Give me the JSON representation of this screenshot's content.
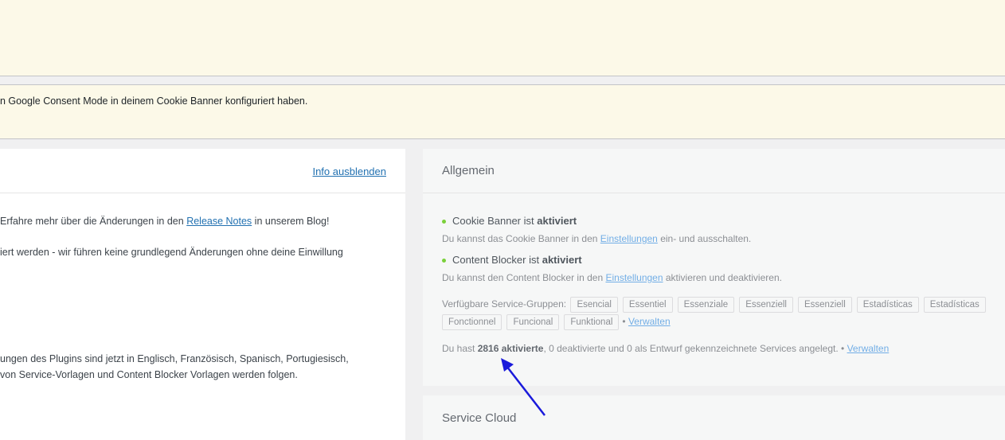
{
  "consent_notice": {
    "text": "n Google Consent Mode in deinem Cookie Banner konfiguriert haben."
  },
  "left_card": {
    "hide_info_link": "Info ausblenden",
    "line1_prefix": "Erfahre mehr über die Änderungen in den ",
    "line1_link": "Release Notes",
    "line1_suffix": " in unserem Blog!",
    "line2": "iert werden - wir führen keine grundlegend Änderungen ohne deine Einwillung",
    "line3": "ungen des Plugins sind jetzt in Englisch, Französisch, Spanisch, Portugiesisch,",
    "line4": "von Service-Vorlagen und Content Blocker Vorlagen werden folgen."
  },
  "general": {
    "title": "Allgemein",
    "cookie_banner": {
      "label": "Cookie Banner ist ",
      "status": "aktiviert",
      "help_prefix": "Du kannst das Cookie Banner in den ",
      "help_link": "Einstellungen",
      "help_suffix": " ein- und ausschalten."
    },
    "content_blocker": {
      "label": "Content Blocker ist ",
      "status": "aktiviert",
      "help_prefix": "Du kannst den Content Blocker in den ",
      "help_link": "Einstellungen",
      "help_suffix": " aktivieren und deaktivieren."
    },
    "service_groups": {
      "label": "Verfügbare Service-Gruppen:",
      "groups": [
        "Esencial",
        "Essentiel",
        "Essenziale",
        "Essenziell",
        "Essenziell",
        "Estadísticas",
        "Estadísticas",
        "Fonctionnel",
        "Funcional",
        "Funktional"
      ],
      "separator": "•",
      "manage_link": "Verwalten"
    },
    "services": {
      "prefix": "Du hast ",
      "active": "2816 aktivierte",
      "suffix": ", 0 deaktivierte und 0 als Entwurf gekennzeichnete Services angelegt.",
      "separator": "•",
      "manage_link": "Verwalten"
    }
  },
  "service_cloud": {
    "title": "Service Cloud"
  },
  "colors": {
    "notice_bg": "#fcf9e8",
    "status_dot": "#7ad03a",
    "link": "#2271b1",
    "annotation_arrow": "#1a1adb"
  }
}
